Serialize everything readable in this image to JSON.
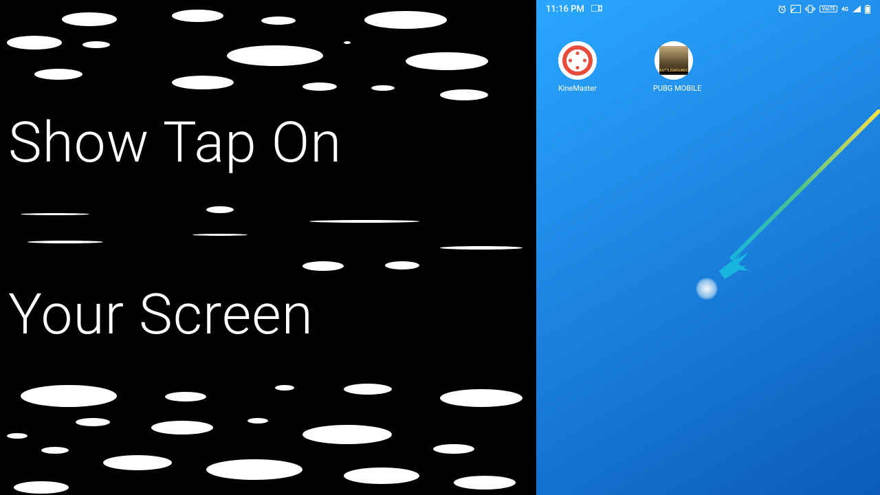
{
  "left": {
    "line1": "Show Tap On",
    "line2": "Your  Screen"
  },
  "status": {
    "time": "11:16 PM",
    "icons": {
      "camcorder": "⧐",
      "alarm": "⏰",
      "cast": "⎚",
      "vibrate": "📳",
      "volte": "VoLTE",
      "network": "4G",
      "signal": "◢",
      "battery": "▮"
    }
  },
  "apps": {
    "kinemaster": {
      "label": "KineMaster"
    },
    "pubg": {
      "label": "PUBG MOBILE",
      "inner_text": "BATTLEGROUNDS"
    }
  }
}
